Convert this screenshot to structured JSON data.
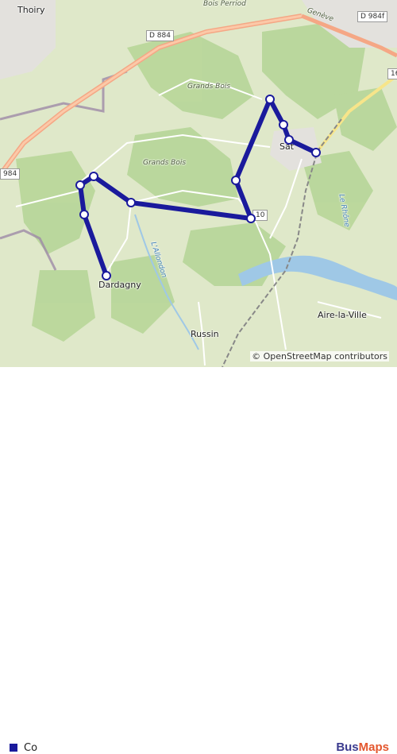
{
  "map": {
    "place_labels": {
      "thoiry": "Thoiry",
      "bois_perriod": "Bois Perriod",
      "geneve": "Genève",
      "grands_bois_1": "Grands Bois",
      "grands_bois_2": "Grands Bois",
      "satigny": "Sat",
      "dardagny": "Dardagny",
      "allondon": "L'Allondon",
      "aire_la_ville": "Aire-la-Ville",
      "russin": "Russin",
      "rhone": "Le Rhône"
    },
    "road_refs": {
      "d884_top": "D 884",
      "d884_left": "984",
      "d984f": "D 984f",
      "r10": "10",
      "r16": "16"
    },
    "route_color": "#1a1a9c",
    "water_color": "#9fc8e6",
    "forest_color": "#b8d69a"
  },
  "attribution": "© OpenStreetMap contributors",
  "legend": {
    "label": "Co",
    "color": "#1a1a9c"
  },
  "brand": {
    "part1": "Bus",
    "part2": "Maps"
  }
}
